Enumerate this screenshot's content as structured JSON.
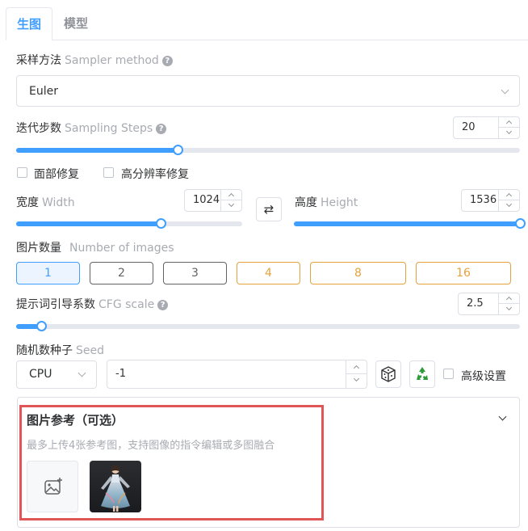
{
  "tabs": [
    {
      "label": "生图",
      "active": true
    },
    {
      "label": "模型",
      "active": false
    }
  ],
  "sampler": {
    "label_cn": "采样方法",
    "label_en": "Sampler method",
    "value": "Euler"
  },
  "steps": {
    "label_cn": "迭代步数",
    "label_en": "Sampling Steps",
    "value": "20",
    "slider_fraction": 0.32
  },
  "options": {
    "face_restore": "面部修复",
    "hires_fix": "高分辨率修复"
  },
  "width": {
    "label_cn": "宽度",
    "label_en": "Width",
    "value": "1024",
    "slider_fraction": 0.64
  },
  "height": {
    "label_cn": "高度",
    "label_en": "Height",
    "value": "1536",
    "slider_fraction": 1.0
  },
  "swap_glyph": "⇄",
  "image_count": {
    "label_cn": "图片数量",
    "label_en": "Number of images",
    "options": [
      "1",
      "2",
      "3",
      "4",
      "8",
      "16"
    ],
    "selected": "1",
    "standard_color": "#606266",
    "premium_color": "#e6a23c"
  },
  "cfg": {
    "label_cn": "提示词引导系数",
    "label_en": "CFG scale",
    "value": "2.5",
    "slider_fraction": 0.05
  },
  "seed": {
    "label_cn": "随机数种子",
    "label_en": "Seed",
    "device": "CPU",
    "value": "-1",
    "dice_icon": "dice-icon",
    "recycle_icon": "recycle-icon"
  },
  "advanced": {
    "label": "高级设置"
  },
  "reference": {
    "title": "图片参考（可选）",
    "description": "最多上传4张参考图，支持图像的指令编辑或多图融合",
    "upload_icon": "image-add-icon",
    "highlight_color": "#e05555"
  },
  "accent_color": "#409eff"
}
